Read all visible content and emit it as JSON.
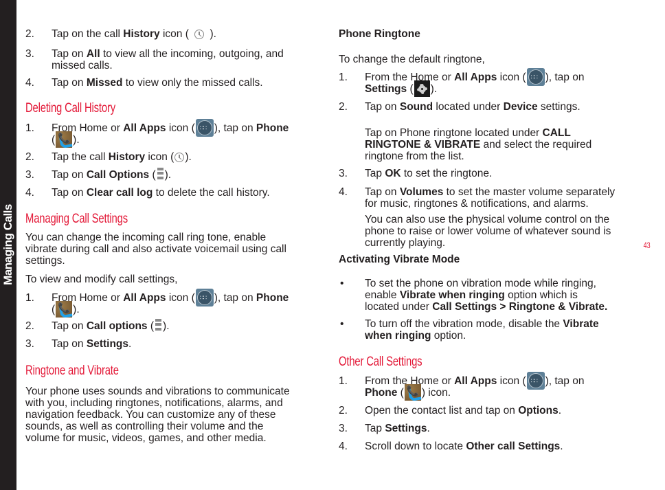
{
  "side_tab": {
    "label": "Managing Calls"
  },
  "page_number": "43",
  "left": {
    "history_steps": [
      {
        "num": "2.",
        "pre": "Tap on the call ",
        "bold": "History",
        "post": " icon (",
        "icon": "history-icon",
        "end": ")."
      },
      {
        "num": "3.",
        "pre": "Tap on ",
        "bold": "All",
        "post": " to view all the incoming, outgoing, and",
        "line2": "missed calls."
      },
      {
        "num": "4.",
        "pre": "Tap on ",
        "bold": "Missed",
        "post": " to view only the missed calls."
      }
    ],
    "deleting": {
      "heading": "Deleting Call History",
      "steps": [
        {
          "num": "1.",
          "pre": "From Home or ",
          "bold": "All Apps",
          "mid": " icon (",
          "mid2": "), tap on ",
          "bold2": "Phone",
          "line2_pre": "(",
          "line2_post": ")."
        },
        {
          "num": "2.",
          "pre": "Tap the call ",
          "bold": "History",
          "post": " icon (",
          "end": ")."
        },
        {
          "num": "3.",
          "pre": "Tap on ",
          "bold": "Call Options",
          "post": " (",
          "end": ")."
        },
        {
          "num": "4.",
          "pre": "Tap on ",
          "bold": "Clear call log",
          "post": " to delete the call history."
        }
      ]
    },
    "managing": {
      "heading": "Managing Call Settings",
      "para1": [
        "You can change the incoming call ring tone, enable",
        "vibrate during call and also activate voicemail using call",
        "settings."
      ],
      "para2": "To view and modify call settings,",
      "steps": [
        {
          "num": "1.",
          "pre": "From Home or ",
          "bold": "All Apps",
          "mid": " icon (",
          "mid2": "), tap on ",
          "bold2": "Phone",
          "line2_pre": "(",
          "line2_post": ")."
        },
        {
          "num": "2.",
          "pre": "Tap on ",
          "bold": "Call options",
          "post": " (",
          "end": ")."
        },
        {
          "num": "3.",
          "pre": "Tap on ",
          "bold": "Settings",
          "post": "."
        }
      ]
    },
    "ringtone": {
      "heading": "Ringtone and Vibrate",
      "para": [
        "Your phone uses sounds and vibrations to communicate",
        "with you, including ringtones, notifications, alarms, and",
        "navigation feedback. You can customize any of these",
        "sounds, as well as controlling their volume and the",
        "volume for music, videos, games, and other media."
      ]
    }
  },
  "right": {
    "phone_ringtone": {
      "heading": "Phone Ringtone",
      "intro": "To change the default ringtone,",
      "steps": [
        {
          "num": "1.",
          "pre": "From the Home or ",
          "bold": "All Apps",
          "mid": " icon (",
          "mid2": "), tap on",
          "line2_bold": "Settings",
          "line2_pre": " (",
          "line2_post": ")."
        },
        {
          "num": "2.",
          "pre": "Tap on ",
          "bold": "Sound",
          "mid": " located under ",
          "bold2": "Device",
          "post": " settings."
        },
        {
          "sub_pre": "Tap on Phone ringtone located under ",
          "sub_bold": "CALL",
          "sub_line2_bold": "RINGTONE & VIBRATE",
          "sub_line2_post": " and select the required",
          "sub_line3": "ringtone from the list."
        },
        {
          "num": "3.",
          "pre": "Tap ",
          "bold": "OK",
          "post": " to set the ringtone."
        },
        {
          "num": "4.",
          "pre": "Tap on ",
          "bold": "Volumes",
          "post": " to set the master volume separately",
          "line2": "for music, ringtones & notifications, and alarms."
        }
      ],
      "note": [
        "You can also use the physical volume control on the",
        "phone to raise or lower volume of whatever sound is",
        "currently playing."
      ]
    },
    "vibrate_mode": {
      "heading": "Activating Vibrate Mode",
      "bullets": [
        {
          "l1": "To set the phone on vibration mode while ringing,",
          "l2_pre": "enable ",
          "l2_bold": "Vibrate when ringing",
          "l2_post": " option which is",
          "l3_pre": "located under ",
          "l3_bold": "Call Settings > Ringtone & Vibrate."
        },
        {
          "l1_pre": "To turn off the vibration mode, disable the ",
          "l1_bold": "Vibrate",
          "l2_bold": "when ringing",
          "l2_post": " option."
        }
      ],
      "bullet_char": "•"
    },
    "other": {
      "heading": "Other Call Settings",
      "steps": [
        {
          "num": "1.",
          "pre": "From the Home or ",
          "bold": "All Apps",
          "mid": " icon (",
          "mid2": "), tap on",
          "line2_bold": "Phone",
          "line2_pre": " (",
          "line2_post": ") icon."
        },
        {
          "num": "2.",
          "pre": "Open the contact list and tap on ",
          "bold": "Options",
          "post": "."
        },
        {
          "num": "3.",
          "pre": "Tap ",
          "bold": "Settings",
          "post": "."
        },
        {
          "num": "4.",
          "pre": "Scroll down to locate ",
          "bold": "Other call Settings",
          "post": "."
        }
      ]
    }
  }
}
